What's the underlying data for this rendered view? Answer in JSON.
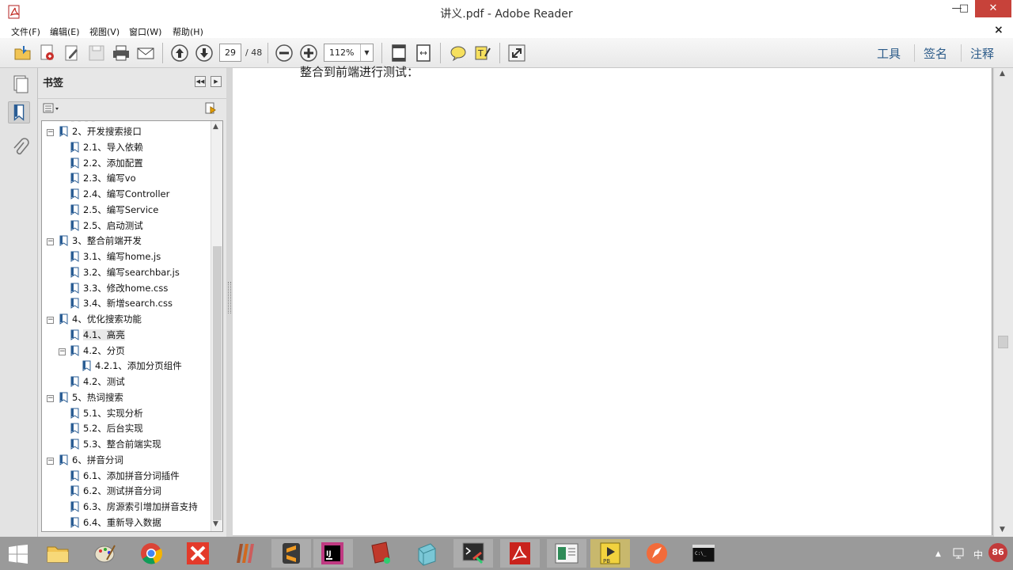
{
  "window": {
    "title": "讲义.pdf - Adobe Reader",
    "min": "—",
    "max": "□",
    "close": "✕"
  },
  "menu": {
    "items": [
      "文件(F)",
      "编辑(E)",
      "视图(V)",
      "窗口(W)",
      "帮助(H)"
    ],
    "close": "×"
  },
  "toolbar": {
    "current_page": "29",
    "total_pages": "/ 48",
    "zoom": "112%",
    "tabs": [
      "工具",
      "签名",
      "注释"
    ]
  },
  "bookmarks": {
    "title": "书签",
    "items": [
      {
        "label": "2、开发搜索接口",
        "level": 0,
        "expander": "⊟"
      },
      {
        "label": "2.1、导入依赖",
        "level": 1
      },
      {
        "label": "2.2、添加配置",
        "level": 1
      },
      {
        "label": "2.3、编写vo",
        "level": 1
      },
      {
        "label": "2.4、编写Controller",
        "level": 1
      },
      {
        "label": "2.5、编写Service",
        "level": 1
      },
      {
        "label": "2.5、启动测试",
        "level": 1
      },
      {
        "label": "3、整合前端开发",
        "level": 0,
        "expander": "⊟"
      },
      {
        "label": "3.1、编写home.js",
        "level": 1
      },
      {
        "label": "3.2、编写searchbar.js",
        "level": 1
      },
      {
        "label": "3.3、修改home.css",
        "level": 1
      },
      {
        "label": "3.4、新增search.css",
        "level": 1
      },
      {
        "label": "4、优化搜索功能",
        "level": 0,
        "expander": "⊟"
      },
      {
        "label": "4.1、高亮",
        "level": 1
      },
      {
        "label": "4.2、分页",
        "level": 1,
        "expander": "⊟"
      },
      {
        "label": "4.2.1、添加分页组件",
        "level": 2
      },
      {
        "label": "4.2、测试",
        "level": 1
      },
      {
        "label": "5、热词搜索",
        "level": 0,
        "expander": "⊟"
      },
      {
        "label": "5.1、实现分析",
        "level": 1
      },
      {
        "label": "5.2、后台实现",
        "level": 1
      },
      {
        "label": "5.3、整合前端实现",
        "level": 1
      },
      {
        "label": "6、拼音分词",
        "level": 0,
        "expander": "⊟"
      },
      {
        "label": "6.1、添加拼音分词插件",
        "level": 1
      },
      {
        "label": "6.2、测试拼音分词",
        "level": 1
      },
      {
        "label": "6.3、房源索引增加拼音支持",
        "level": 1
      },
      {
        "label": "6.4、重新导入数据",
        "level": 1
      }
    ]
  },
  "document": {
    "visible_text": "整合到前端进行测试："
  },
  "taskbar": {
    "tray_ime": "中",
    "badge": "86"
  }
}
